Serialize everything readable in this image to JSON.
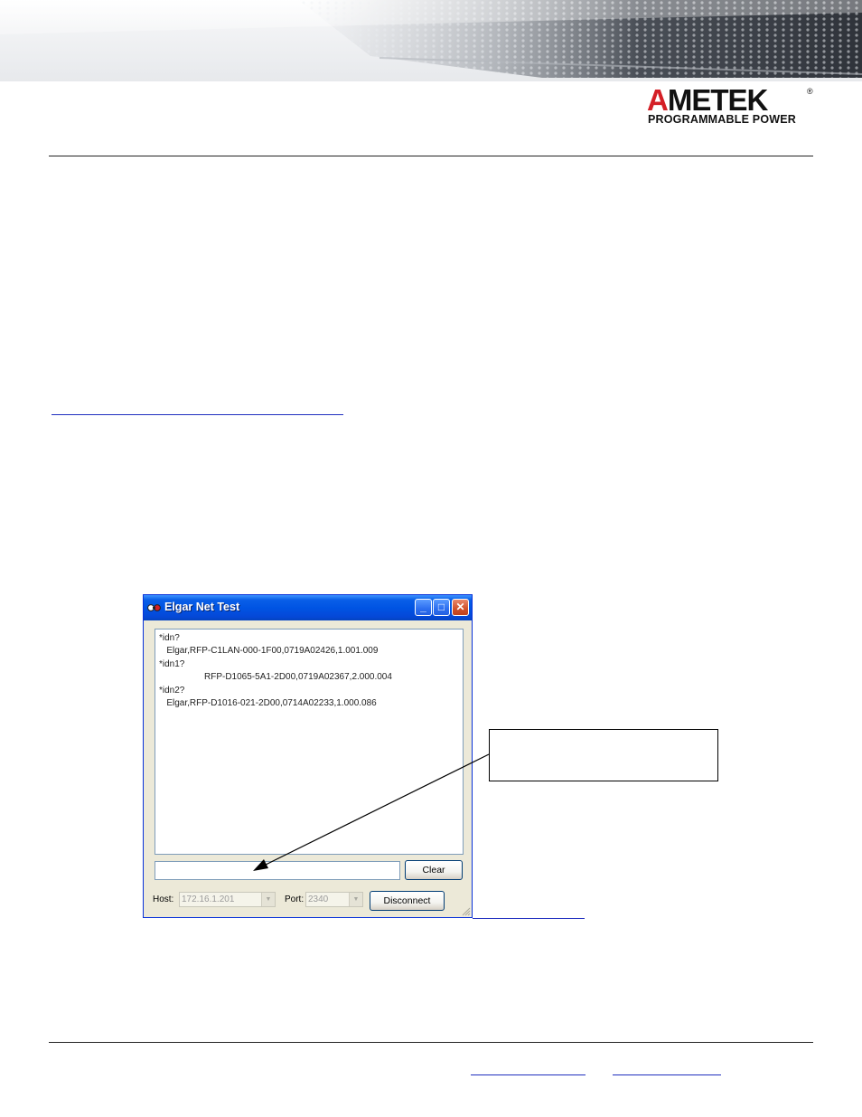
{
  "header": {
    "logo_word_first": "A",
    "logo_word_rest": "METEK",
    "logo_registered": "®",
    "logo_subtitle": "PROGRAMMABLE POWER",
    "brand_red": "#d41f26"
  },
  "window": {
    "title": "Elgar Net Test",
    "titlebar_color": "#0054e3",
    "controls": {
      "minimize": "_",
      "maximize": "□",
      "close": "✕"
    },
    "output_lines": [
      "*idn?",
      "   Elgar,RFP-C1LAN-000-1F00,0719A02426,1.001.009",
      "*idn1?",
      "                  RFP-D1065-5A1-2D00,0719A02367,2.000.004",
      "*idn2?",
      "   Elgar,RFP-D1016-021-2D00,0714A02233,1.000.086"
    ],
    "command_value": "",
    "clear_label": "Clear",
    "host_label": "Host:",
    "host_value": "172.16.1.201",
    "port_label": "Port:",
    "port_value": "2340",
    "disconnect_label": "Disconnect"
  },
  "callout": {
    "text": ""
  }
}
